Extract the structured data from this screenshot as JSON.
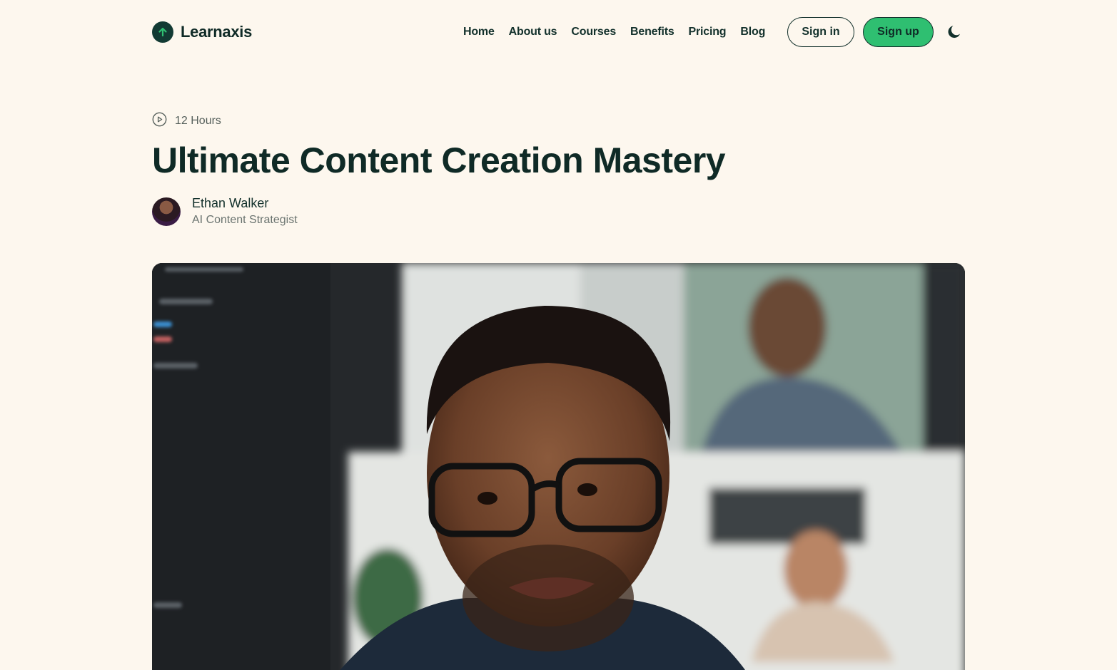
{
  "brand": {
    "name": "Learnaxis",
    "logo_icon": "arrow-up-icon"
  },
  "nav": {
    "items": [
      {
        "label": "Home"
      },
      {
        "label": "About us"
      },
      {
        "label": "Courses"
      },
      {
        "label": "Benefits"
      },
      {
        "label": "Pricing"
      },
      {
        "label": "Blog"
      }
    ],
    "sign_in": "Sign in",
    "sign_up": "Sign up",
    "theme_icon": "moon-icon"
  },
  "course": {
    "duration_icon": "play-circle-icon",
    "duration": "12 Hours",
    "title": "Ultimate Content Creation Mastery",
    "author": {
      "name": "Ethan Walker",
      "role": "AI Content Strategist"
    }
  },
  "colors": {
    "background": "#fdf7ee",
    "text": "#0f2a26",
    "accent": "#2fbf71"
  }
}
